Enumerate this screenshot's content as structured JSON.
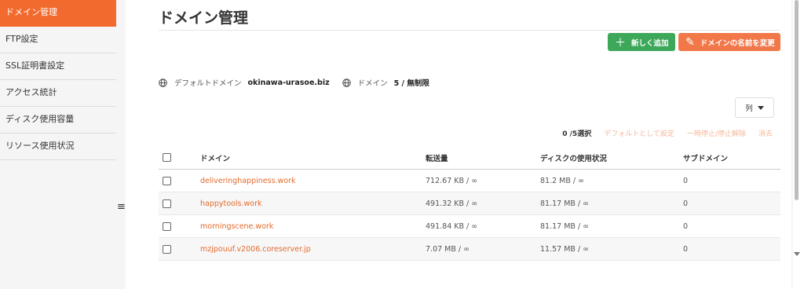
{
  "sidebar": {
    "items": [
      {
        "label": "ドメイン管理",
        "active": true
      },
      {
        "label": "FTP設定"
      },
      {
        "label": "SSL証明書設定"
      },
      {
        "label": "アクセス統計"
      },
      {
        "label": "ディスク使用容量"
      },
      {
        "label": "リソース使用状況"
      }
    ]
  },
  "menu_toggle": "≡",
  "page": {
    "title": "ドメイン管理",
    "add_button": "新しく追加",
    "add_icon": "＋",
    "rename_button": "ドメインの名前を変更",
    "rename_icon": "✎"
  },
  "info": {
    "default_domain_label": "デフォルトドメイン",
    "default_domain_value": "okinawa-urasoe.biz",
    "domain_label": "ドメイン",
    "domain_value": "5 / 無制限"
  },
  "column_button": "列",
  "actions": {
    "selection_count": "0 /5選択",
    "set_default": "デフォルトとして設定",
    "pause_resume": "一時停止/停止解除",
    "delete": "消去"
  },
  "table": {
    "headers": [
      "ドメイン",
      "転送量",
      "ディスクの使用状況",
      "サブドメイン"
    ],
    "rows": [
      {
        "domain": "deliveringhappiness.work",
        "transfer": "712.67 KB / ∞",
        "disk": "81.2 MB / ∞",
        "subdomains": "0"
      },
      {
        "domain": "happytools.work",
        "transfer": "491.32 KB / ∞",
        "disk": "81.17 MB / ∞",
        "subdomains": "0"
      },
      {
        "domain": "morningscene.work",
        "transfer": "491.84 KB / ∞",
        "disk": "81.17 MB / ∞",
        "subdomains": "0"
      },
      {
        "domain": "mzjpouuf.v2006.coreserver.jp",
        "transfer": "7.07 MB / ∞",
        "disk": "11.57 MB / ∞",
        "subdomains": "0"
      }
    ]
  },
  "colors": {
    "accent": "#f26a2e",
    "add_green": "#3ea85a",
    "rename_orange": "#f2784a",
    "link": "#e4692a"
  }
}
